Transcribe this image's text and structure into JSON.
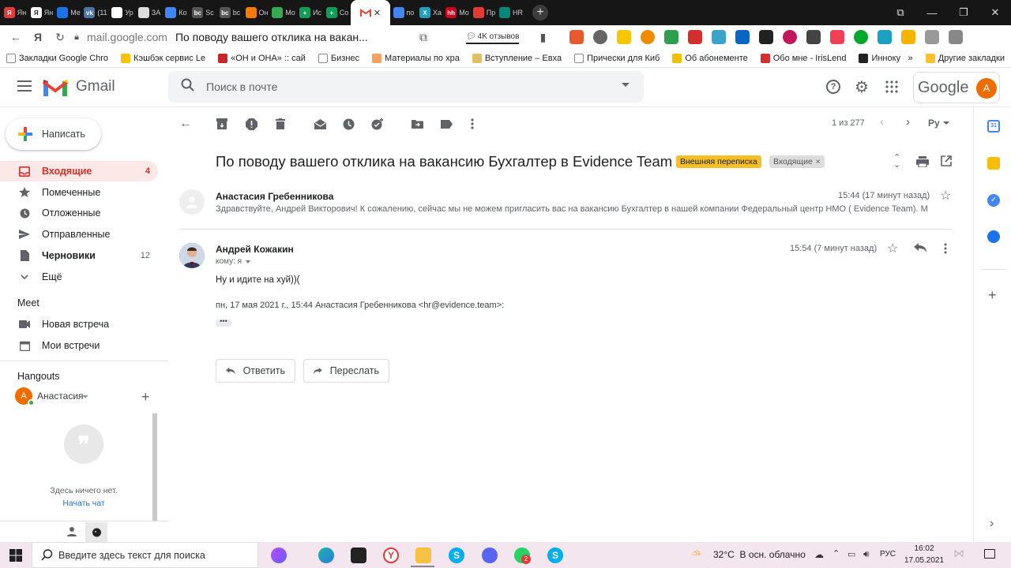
{
  "browser": {
    "tabs": [
      {
        "label": "Ян",
        "color": "#e53935",
        "glyph": "Я"
      },
      {
        "label": "Ян",
        "color": "#ffffff",
        "glyph": "Я"
      },
      {
        "label": "Ме",
        "color": "#1a73e8",
        "glyph": ""
      },
      {
        "label": "(11",
        "color": "#4a76a8",
        "glyph": "vk"
      },
      {
        "label": "Ур",
        "color": "#ffffff",
        "glyph": ""
      },
      {
        "label": "ЗА",
        "color": "#dddddd",
        "glyph": ""
      },
      {
        "label": "Ко",
        "color": "#4285f4",
        "glyph": ""
      },
      {
        "label": "Sc",
        "color": "#555555",
        "glyph": "bc"
      },
      {
        "label": "bc",
        "color": "#555555",
        "glyph": "bc"
      },
      {
        "label": "Он",
        "color": "#f57c00",
        "glyph": ""
      },
      {
        "label": "Мо",
        "color": "#34a853",
        "glyph": ""
      },
      {
        "label": "Ис",
        "color": "#0f9d58",
        "glyph": "+"
      },
      {
        "label": "Со",
        "color": "#0f9d58",
        "glyph": "+"
      }
    ],
    "tabs_after": [
      {
        "label": "по",
        "color": "#4285f4",
        "glyph": ""
      },
      {
        "label": "Ха",
        "color": "#1da1c2",
        "glyph": "X"
      },
      {
        "label": "Мо",
        "color": "#d6001c",
        "glyph": "hh"
      },
      {
        "label": "Пр",
        "color": "#e53935",
        "glyph": ""
      },
      {
        "label": "HR",
        "color": "#00897b",
        "glyph": ""
      }
    ],
    "active_tab_icon": "gmail-icon",
    "url_host": "mail.google.com",
    "url_title": "По поводу вашего отклика на вакан...",
    "reviews_label": "4K отзывов",
    "bookmarks": [
      {
        "label": "Закладки Google Chro",
        "color": "#ffffff"
      },
      {
        "label": "Кэшбэк сервис Le",
        "color": "#f9c300"
      },
      {
        "label": "«ОН и ОНА» :: сай",
        "color": "#c62828"
      },
      {
        "label": "Бизнес",
        "color": "#ffffff"
      },
      {
        "label": "Материалы по хра",
        "color": "#f4a261"
      },
      {
        "label": "Вступление – Евха",
        "color": "#e0c060"
      },
      {
        "label": "Прически для Киб",
        "color": "#ffffff"
      },
      {
        "label": "Об абонементе",
        "color": "#f2c200"
      },
      {
        "label": "Обо мне - IrisLend",
        "color": "#d32f2f"
      },
      {
        "label": "Инноку",
        "color": "#222222"
      }
    ],
    "other_bookmarks": "Другие закладки"
  },
  "gmail": {
    "logo_text": "Gmail",
    "search_placeholder": "Поиск в почте",
    "google_text": "Google",
    "account_initial": "А",
    "compose_label": "Написать",
    "nav": [
      {
        "label": "Входящие",
        "count": "4",
        "icon": "inbox-icon",
        "active": true
      },
      {
        "label": "Помеченные",
        "count": "",
        "icon": "star-icon"
      },
      {
        "label": "Отложенные",
        "count": "",
        "icon": "clock-icon"
      },
      {
        "label": "Отправленные",
        "count": "",
        "icon": "send-icon"
      },
      {
        "label": "Черновики",
        "count": "12",
        "icon": "draft-icon"
      },
      {
        "label": "Ещё",
        "count": "",
        "icon": "chevron-down-icon"
      }
    ],
    "meet_title": "Meet",
    "meet_items": [
      "Новая встреча",
      "Мои встречи"
    ],
    "hangouts_title": "Hangouts",
    "hangouts_user": "Анастасия",
    "hangouts_initial": "А",
    "hangouts_empty": "Здесь ничего нет.",
    "hangouts_start": "Начать чат",
    "pagination": "1 из 277",
    "lang": "Ру",
    "subject": "По поводу вашего отклика на вакансию Бухгалтер в Evidence Team",
    "label_external": "Внешняя переписка",
    "label_inbox": "Входящие",
    "messages": [
      {
        "sender": "Анастасия Гребенникова",
        "time": "15:44 (17 минут назад)",
        "snippet": "Здравствуйте, Андрей Викторович! К сожалению, сейчас мы не можем пригласить вас на вакансию Бухгалтер в нашей компании Федеральный центр НМО ( Evidence Team). М"
      },
      {
        "sender": "Андрей Кожакин",
        "time": "15:54 (7 минут назад)",
        "to": "кому: я",
        "body": "Ну и идите на хуй))(",
        "quote_header": "пн, 17 мая 2021 г., 15:44 Анастасия Гребенникова <hr@evidence.team>:"
      }
    ],
    "reply_label": "Ответить",
    "forward_label": "Переслать"
  },
  "taskbar": {
    "search_placeholder": "Введите здесь текст для поиска",
    "weather": "32°C  В осн. облачно",
    "lang": "РУС",
    "time": "16:02",
    "date": "17.05.2021",
    "whatsapp_badge": "2"
  }
}
